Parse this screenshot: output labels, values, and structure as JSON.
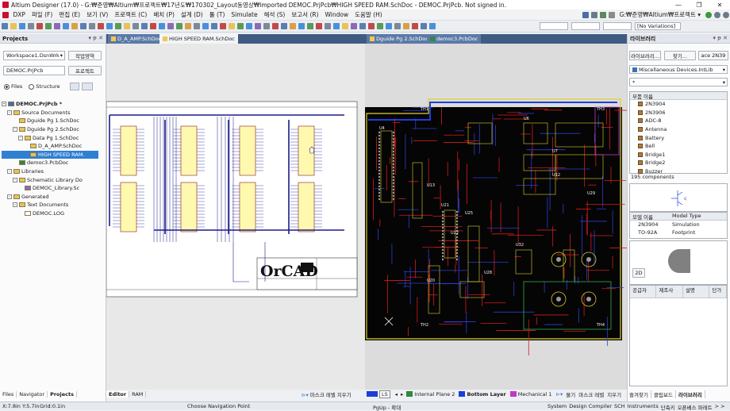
{
  "title": "Altium Designer (17.0) - G:₩준영₩Altium₩프로젝트₩17년도₩170302_Layout동영상₩Imported DEMOC.PrjPcb₩HIGH SPEED RAM.SchDoc - DEMOC.PrjPcb. Not signed in.",
  "menu": [
    "DXP",
    "파일 (F)",
    "편집 (E)",
    "보기 (V)",
    "프로젝트 (C)",
    "배치 (P)",
    "설계 (D)",
    "툴 (T)",
    "Simulate",
    "해석 (S)",
    "보고서 (R)",
    "Window",
    "도움말 (H)"
  ],
  "path_combo": "G:₩준영₩Altium₩프로젝트 ▾",
  "variations": "[No Variations]",
  "projects": {
    "header": "Projects",
    "workspace": "Workspace1.DsnWrk",
    "workspace_btn": "작업영역",
    "project": "DEMOC.PrjPcb",
    "project_btn": "프로젝트",
    "files_label": "Files",
    "structure_label": "Structure",
    "tree": [
      {
        "label": "DEMOC.PrjPcb *",
        "indent": 0,
        "sel": false,
        "bold": true,
        "tog": "-",
        "fill": "#3c6fb3"
      },
      {
        "label": "Source Documents",
        "indent": 1,
        "sel": false,
        "bold": false,
        "tog": "-",
        "fill": "#e7c35a"
      },
      {
        "label": "Dguide Pg 1.SchDoc",
        "indent": 2,
        "sel": false,
        "bold": false,
        "tog": "",
        "fill": "#e7c35a"
      },
      {
        "label": "Dguide Pg 2.SchDoc",
        "indent": 2,
        "sel": false,
        "bold": false,
        "tog": "-",
        "fill": "#e7c35a"
      },
      {
        "label": "Data Pg 1.SchDoc",
        "indent": 3,
        "sel": false,
        "bold": false,
        "tog": "-",
        "fill": "#e7c35a"
      },
      {
        "label": "D_A_AMP.SchDoc",
        "indent": 4,
        "sel": false,
        "bold": false,
        "tog": "",
        "fill": "#e7c35a"
      },
      {
        "label": "HIGH SPEED RAM.",
        "indent": 4,
        "sel": true,
        "bold": false,
        "tog": "",
        "fill": "#e7c35a"
      },
      {
        "label": "democ3.PcbDoc",
        "indent": 2,
        "sel": false,
        "bold": false,
        "tog": "",
        "fill": "#2d8a3e"
      },
      {
        "label": "Libraries",
        "indent": 1,
        "sel": false,
        "bold": false,
        "tog": "-",
        "fill": "#e7c35a"
      },
      {
        "label": "Schematic Library Do",
        "indent": 2,
        "sel": false,
        "bold": false,
        "tog": "-",
        "fill": "#e7c35a"
      },
      {
        "label": "DEMOC_Library.Sc",
        "indent": 3,
        "sel": false,
        "bold": false,
        "tog": "",
        "fill": "#8a6bb8"
      },
      {
        "label": "Generated",
        "indent": 1,
        "sel": false,
        "bold": false,
        "tog": "-",
        "fill": "#e7c35a"
      },
      {
        "label": "Text Documents",
        "indent": 2,
        "sel": false,
        "bold": false,
        "tog": "-",
        "fill": "#e7c35a"
      },
      {
        "label": "DEMOC.LOG",
        "indent": 3,
        "sel": false,
        "bold": false,
        "tog": "",
        "fill": "#ffffff"
      }
    ],
    "bottom_tabs": [
      "Files",
      "Navigator",
      "Projects"
    ]
  },
  "doc_tabs_left": [
    "D_A_AMP.SchDoc",
    "HIGH SPEED RAM.SchDoc"
  ],
  "doc_tabs_right": [
    "Dguide Pg 2.SchDoc",
    "democ3.PcbDoc"
  ],
  "sch": {
    "logo": "OrCAD",
    "bottom_tabs": [
      "Editor",
      "RAM"
    ],
    "mask": "마스크 레벨 지우기"
  },
  "pcb": {
    "layers": [
      {
        "name": "Internal Plane 2",
        "color": "#2d8a3e",
        "bold": false
      },
      {
        "name": "Bottom Layer",
        "color": "#1c3fd9",
        "bold": true
      },
      {
        "name": "Mechanical 1",
        "color": "#c03ac0",
        "bold": false
      }
    ],
    "ls": "LS",
    "snap": "물기",
    "mask": "마스크 레벨",
    "clear": "지우기",
    "designators": [
      "TH1",
      "TH2",
      "TH3",
      "TH4",
      "U4",
      "U6",
      "U13",
      "U20",
      "U21",
      "U25",
      "U28",
      "U32",
      "U22",
      "U7",
      "U12",
      "U29"
    ]
  },
  "library": {
    "header": "라이브러리",
    "btn1": "라이브러리...",
    "btn2": "찾기...",
    "btn3": "ace 2N39",
    "lib": "Miscellaneous Devices.IntLib",
    "filter": "*",
    "col_header": "부품 이름",
    "components": [
      "2N3904",
      "2N3906",
      "ADC-8",
      "Antenna",
      "Battery",
      "Bell",
      "Bridge1",
      "Bridge2",
      "Buzzer"
    ],
    "count": "195 components",
    "model_col1": "모델 이름",
    "model_col2": "Model Type",
    "models": [
      {
        "name": "2N3904",
        "type": "Simulation"
      },
      {
        "name": "TO-92A",
        "type": "Footprint"
      }
    ],
    "btn_2d": "2D",
    "supplier_cols": [
      "공급자",
      "제조사",
      "설명",
      "단가"
    ],
    "bottom_tabs": [
      "즐겨찾기",
      "클립보드",
      "라이브러리"
    ]
  },
  "status": {
    "coords": "X:7.8in Y:5.7in",
    "grid": "Grid:0.1in",
    "nav": "Choose Navigation Point",
    "zoom": "PgUp - 확대",
    "right": [
      "System",
      "Design Compiler",
      "SCH",
      "Instruments",
      "단축키",
      "오픈베스 파레트",
      "> >"
    ]
  }
}
